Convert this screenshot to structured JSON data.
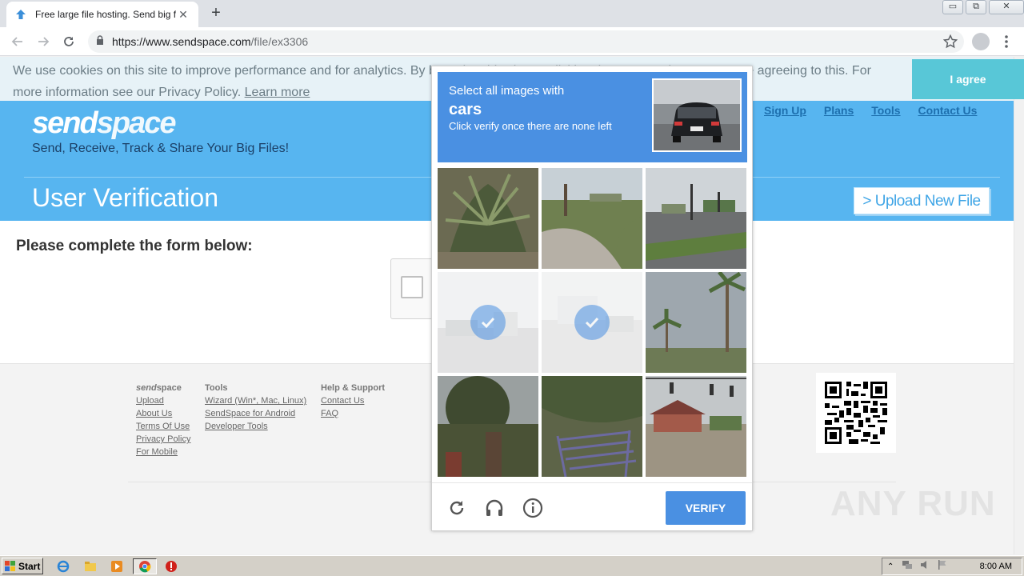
{
  "browser": {
    "tab_title": "Free large file hosting. Send big files",
    "tab_close": "✕",
    "new_tab": "+",
    "url_host": "https://www.sendspace.com",
    "url_path": "/file/ex3306",
    "window_buttons": {
      "minimize": "▭",
      "restore": "⧉",
      "close": "✕"
    }
  },
  "cookie_bar": {
    "text": "We use cookies on this site to improve performance and for analytics. By browsing this site, or clicking the \"I agree\" button, you are agreeing to this. For more information see our Privacy Policy.",
    "learn_more": "Learn more",
    "agree": "I agree"
  },
  "header": {
    "logo_a": "send",
    "logo_b": "space",
    "tagline": "Send, Receive, Track & Share Your Big Files!",
    "nav": [
      "Sign Up",
      "Plans",
      "Tools",
      "Contact Us"
    ],
    "page_title": "User Verification",
    "upload_button": "> Upload New File"
  },
  "form": {
    "heading": "Please complete the form below:"
  },
  "captcha": {
    "line1": "Select all images with",
    "target": "cars",
    "line3": "Click verify once there are none left",
    "verify": "VERIFY",
    "tiles": [
      {
        "name": "palm-bush",
        "selected": false
      },
      {
        "name": "curved-road",
        "selected": false
      },
      {
        "name": "road-intersection",
        "selected": false
      },
      {
        "name": "street-scene",
        "selected": true
      },
      {
        "name": "parking-area",
        "selected": true
      },
      {
        "name": "palm-trees-sky",
        "selected": false
      },
      {
        "name": "tree-bushes",
        "selected": false
      },
      {
        "name": "stairs-path",
        "selected": false
      },
      {
        "name": "traffic-lights-house",
        "selected": false
      }
    ]
  },
  "footer": {
    "col1_head_a": "send",
    "col1_head_b": "space",
    "col1": [
      "Upload",
      "About Us",
      "Terms Of Use",
      "Privacy Policy",
      "For Mobile"
    ],
    "col2_head": "Tools",
    "col2": [
      "Wizard (Win*, Mac, Linux)",
      "SendSpace for Android",
      "Developer Tools"
    ],
    "col3_head": "Help & Support",
    "col3": [
      "Contact Us",
      "FAQ"
    ],
    "watermark": "ANY RUN"
  },
  "taskbar": {
    "start": "Start",
    "clock": "8:00 AM"
  },
  "colors": {
    "sendspace_blue": "#57b5f0",
    "captcha_blue": "#4a90e2",
    "agree_cyan": "#58c7d7"
  }
}
